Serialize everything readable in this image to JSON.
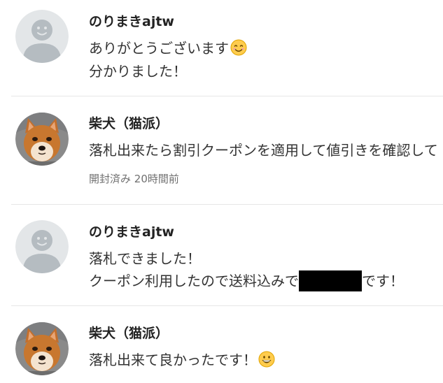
{
  "messages": [
    {
      "author": "のりまきajtw",
      "avatar": "default-avatar-icon",
      "lines": [
        "ありがとうございます",
        "分かりました！"
      ],
      "emoji": "smiling-face-icon"
    },
    {
      "author": "柴犬（猫派）",
      "avatar": "shiba-dog-photo",
      "lines": [
        "落札出来たら割引クーポンを適用して値引きを確認して"
      ],
      "status": "開封済み",
      "time": "20時間前"
    },
    {
      "author": "のりまきajtw",
      "avatar": "default-avatar-icon",
      "lines": [
        "落札できました！",
        "クーポン利用したので送料込みで",
        "です！"
      ],
      "redacted": true
    },
    {
      "author": "柴犬（猫派）",
      "avatar": "shiba-dog-photo",
      "lines": [
        "落札出来て良かったです！"
      ],
      "emoji": "grinning-face-icon"
    }
  ],
  "colors": {
    "text": "#333333",
    "author": "#222222",
    "meta": "#707070",
    "divider": "#e6e6e6",
    "avatar_bg": "#e3e6e8",
    "avatar_fg": "#b5bcc1"
  }
}
